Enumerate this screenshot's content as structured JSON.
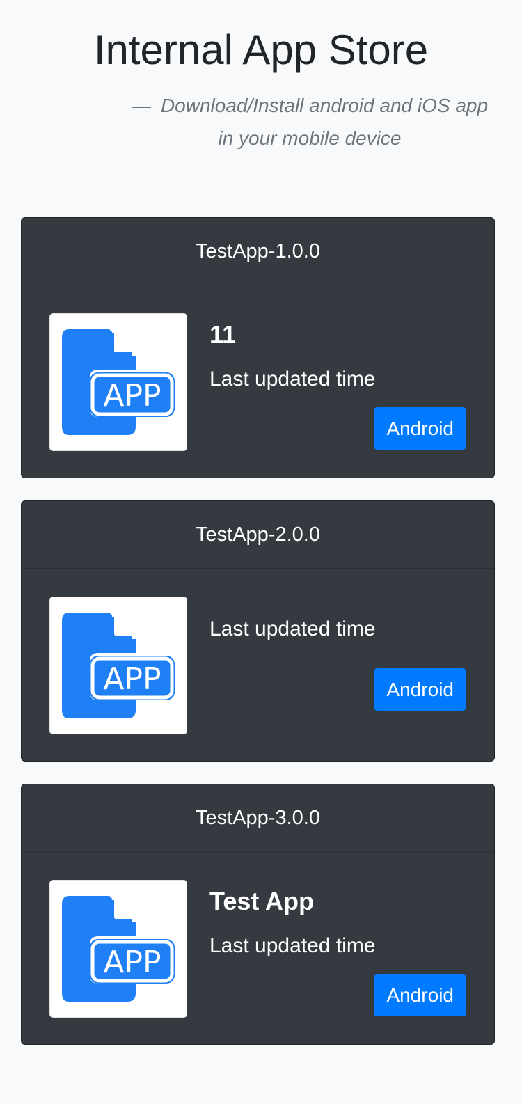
{
  "page": {
    "title": "Internal App Store",
    "subtitle_dash": "—",
    "subtitle": "Download/Install android and iOS app in your mobile device"
  },
  "cards": [
    {
      "header": "TestApp-1.0.0",
      "name": "11",
      "updated_label": "Last updated time",
      "button_label": "Android",
      "icon": "app-file-icon"
    },
    {
      "header": "TestApp-2.0.0",
      "name": "",
      "updated_label": "Last updated time",
      "button_label": "Android",
      "icon": "app-file-icon"
    },
    {
      "header": "TestApp-3.0.0",
      "name": "Test App",
      "updated_label": "Last updated time",
      "button_label": "Android",
      "icon": "app-file-icon"
    }
  ],
  "colors": {
    "background": "#f8f9fa",
    "card": "#343a40",
    "accent": "#007bff",
    "icon_blue": "#1f7ff5",
    "subtitle": "#6c757d"
  }
}
